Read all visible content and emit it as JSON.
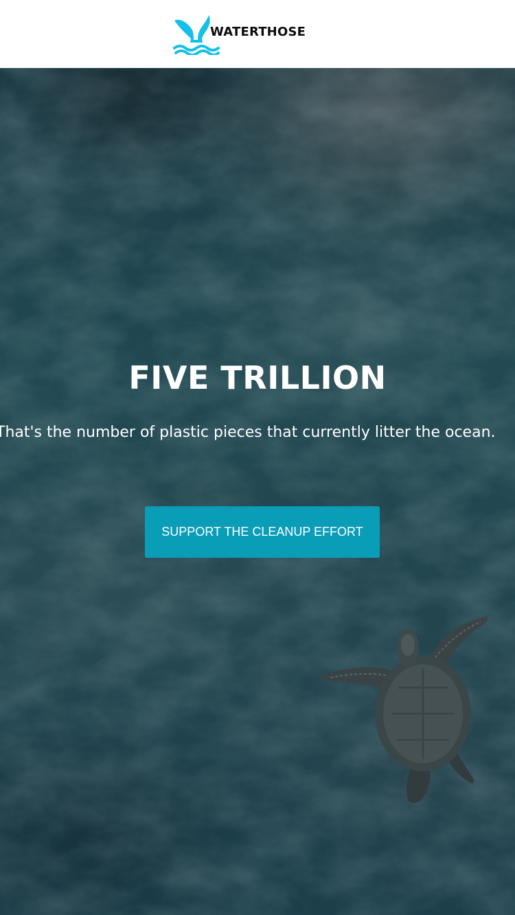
{
  "header": {
    "brand_name": "WATERTHOSE",
    "logo_icon": "whale-tail-icon",
    "brand_color": "#15c0e8"
  },
  "hero": {
    "headline": "FIVE TRILLION",
    "subline": "That's the number of plastic pieces that currently litter the ocean.",
    "cta_label": "SUPPORT THE CLEANUP EFFORT",
    "cta_color": "#0a9db8",
    "background_image": "sea-turtle-underwater-image"
  }
}
